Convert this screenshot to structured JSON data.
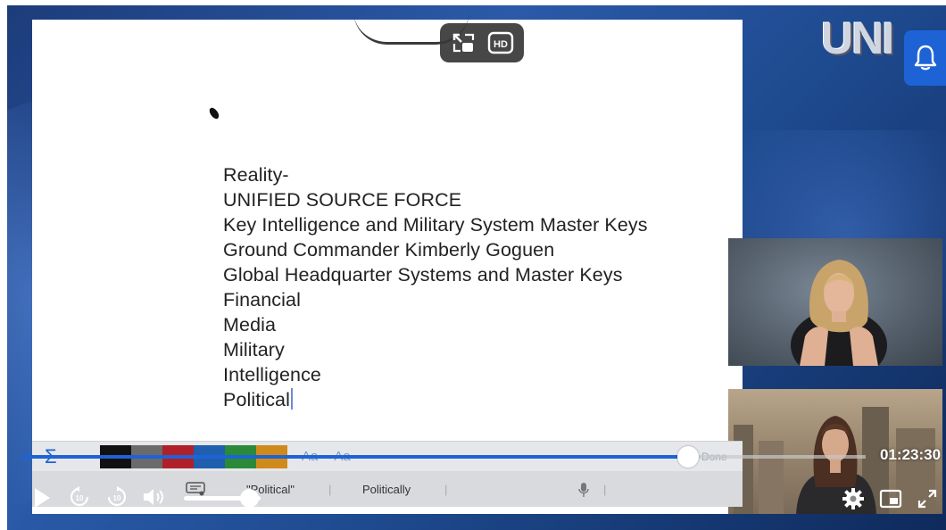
{
  "document": {
    "lines": [
      "Reality-",
      "UNIFIED SOURCE FORCE",
      "Key Intelligence and Military System Master Keys",
      "Ground Commander Kimberly Goguen",
      "Global Headquarter Systems and Master Keys",
      "Financial",
      "Media",
      "Military",
      "Intelligence",
      "Political"
    ]
  },
  "overlay": {
    "hd_label": "HD",
    "icons": [
      "exit-pip-icon",
      "hd-icon"
    ]
  },
  "logo": {
    "text": "UNI"
  },
  "toolbar": {
    "sigma": "Σ",
    "swatch_colors": [
      "#111111",
      "#6b6b6b",
      "#b0202a",
      "#1f5fae",
      "#2b8a3a",
      "#d08a1a"
    ],
    "font_larger": "Aa",
    "font_smaller": "Aa",
    "done_label": "Done"
  },
  "suggestions": {
    "items": [
      "\"Political\"",
      "Politically"
    ],
    "mic_icon": "microphone-icon"
  },
  "player": {
    "time": "01:23:30",
    "progress": 0.79,
    "volume": 0.85,
    "icons": [
      "play-icon",
      "rewind-10-icon",
      "forward-10-icon",
      "volume-icon",
      "settings-icon",
      "miniplayer-icon",
      "fullscreen-icon"
    ]
  },
  "colors": {
    "accent": "#1e63d6",
    "background": "#1d3c7a"
  }
}
